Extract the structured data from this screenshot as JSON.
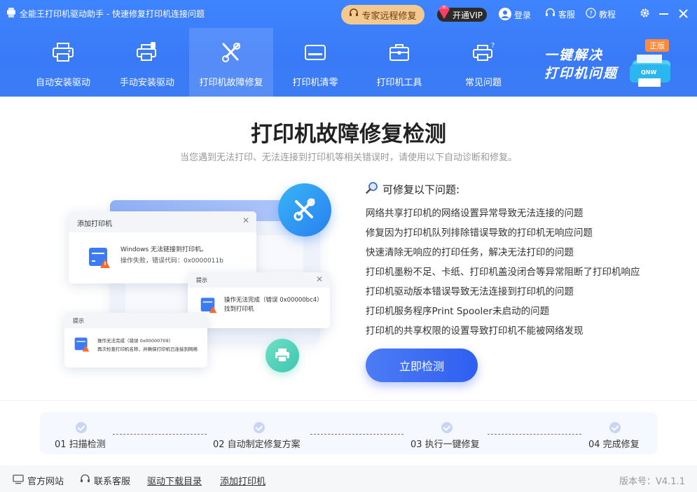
{
  "titlebar": {
    "app_title": "全能王打印机驱动助手 - 快速修复打印机连接问题",
    "remote_label": "专家远程修复",
    "vip_label": "开通VIP",
    "login_label": "登录",
    "service_label": "客服",
    "tutorial_label": "教程"
  },
  "nav": {
    "tabs": [
      {
        "label": "自动安装驱动",
        "icon": "printer-icon"
      },
      {
        "label": "手动安装驱动",
        "icon": "printer-usb-icon"
      },
      {
        "label": "打印机故障修复",
        "icon": "tools-icon"
      },
      {
        "label": "打印机清零",
        "icon": "tray-icon"
      },
      {
        "label": "打印机工具",
        "icon": "toolbox-icon"
      },
      {
        "label": "常见问题",
        "icon": "question-printer-icon"
      }
    ],
    "active_index": 2
  },
  "promo": {
    "line1": "一键解决",
    "line2": "打印机问题",
    "badge": "正版",
    "brand": "QNW"
  },
  "main": {
    "title": "打印机故障修复检测",
    "subtitle": "当您遇到无法打印、无法连接到打印机等相关错误时，请使用以下自动诊断和修复。",
    "issues_heading": "可修复以下问题:",
    "issues": [
      "网络共享打印机的网络设置异常导致无法连接的问题",
      "修复因为打印机队列排除错误导致的打印机无响应问题",
      "快速清除无响应的打印任务，解决无法打印的问题",
      "打印机墨粉不足、卡纸、打印机盖没闭合等异常阻断了打印机响应",
      "打印机驱动版本错误导致无法连接到打印机的问题",
      "打印机服务程序Print Spooler未启动的问题",
      "打印机的共享权限的设置导致打印机不能被网络发现"
    ],
    "detect_button": "立即检测"
  },
  "illustration": {
    "win1": {
      "title": "添加打印机",
      "line1": "Windows 无法链接到打印机。",
      "line2": "操作失败，错误代码：0x0000011b"
    },
    "win2": {
      "title": "提示",
      "line1": "操作无法完成（错误 0x00000bc4）",
      "line2": "找到打印机"
    },
    "win3": {
      "title": "提示",
      "line1": "操作无法完成（错误 0x00000709）",
      "line2": "再次检查打印机名称，并确保打印机已连接到网络"
    }
  },
  "steps": [
    {
      "label": "01 扫描检测"
    },
    {
      "label": "02 自动制定修复方案"
    },
    {
      "label": "03 执行一键修复"
    },
    {
      "label": "04 完成修复"
    }
  ],
  "footer": {
    "website": "官方网站",
    "service": "联系客服",
    "driver_dir": "驱动下载目录",
    "add_printer": "添加打印机",
    "version": "版本号：V4.1.1"
  },
  "colors": {
    "header_blue": "#3b7cf5",
    "remote_btn": "#f4c98f",
    "accent_blue": "#2f5ff0",
    "orange_badge": "#ff8a3d"
  }
}
